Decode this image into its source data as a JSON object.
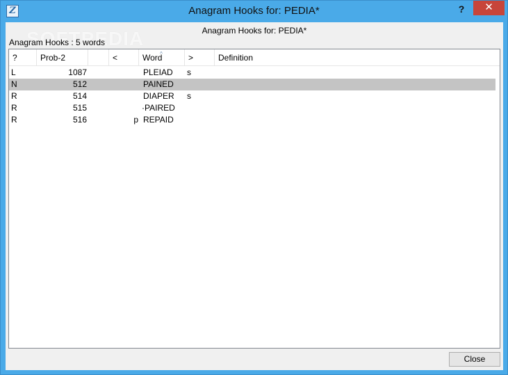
{
  "window": {
    "title": "Anagram Hooks for: PEDIA*",
    "icon_letter": "Z",
    "help_label": "?",
    "close_label": "✕"
  },
  "watermark": "SOFTPEDIA",
  "dialog": {
    "heading": "Anagram Hooks for: PEDIA*",
    "count_label": "Anagram Hooks : 5 words",
    "close_button": "Close"
  },
  "table": {
    "columns": [
      "?",
      "Prob-2",
      "<",
      "Word",
      ">",
      "Definition"
    ],
    "sort_indicator": "^",
    "rows": [
      {
        "q": "L",
        "prob": "1087",
        "front": "",
        "word": "PLEIAD",
        "back": "s",
        "definition": "",
        "selected": false
      },
      {
        "q": "N",
        "prob": "512",
        "front": "",
        "word": "PAINED",
        "back": "",
        "definition": "",
        "selected": true
      },
      {
        "q": "R",
        "prob": "514",
        "front": "",
        "word": "DIAPER",
        "back": "s",
        "definition": "",
        "selected": false
      },
      {
        "q": "R",
        "prob": "515",
        "front": "",
        "word": "·PAIRED",
        "back": "",
        "definition": "",
        "selected": false
      },
      {
        "q": "R",
        "prob": "516",
        "front": "p",
        "word": "REPAID",
        "back": "",
        "definition": "",
        "selected": false
      }
    ]
  },
  "colors": {
    "titlebar": "#4aaae8",
    "close_red": "#c7453a",
    "selected_row": "#c4c4c4"
  }
}
